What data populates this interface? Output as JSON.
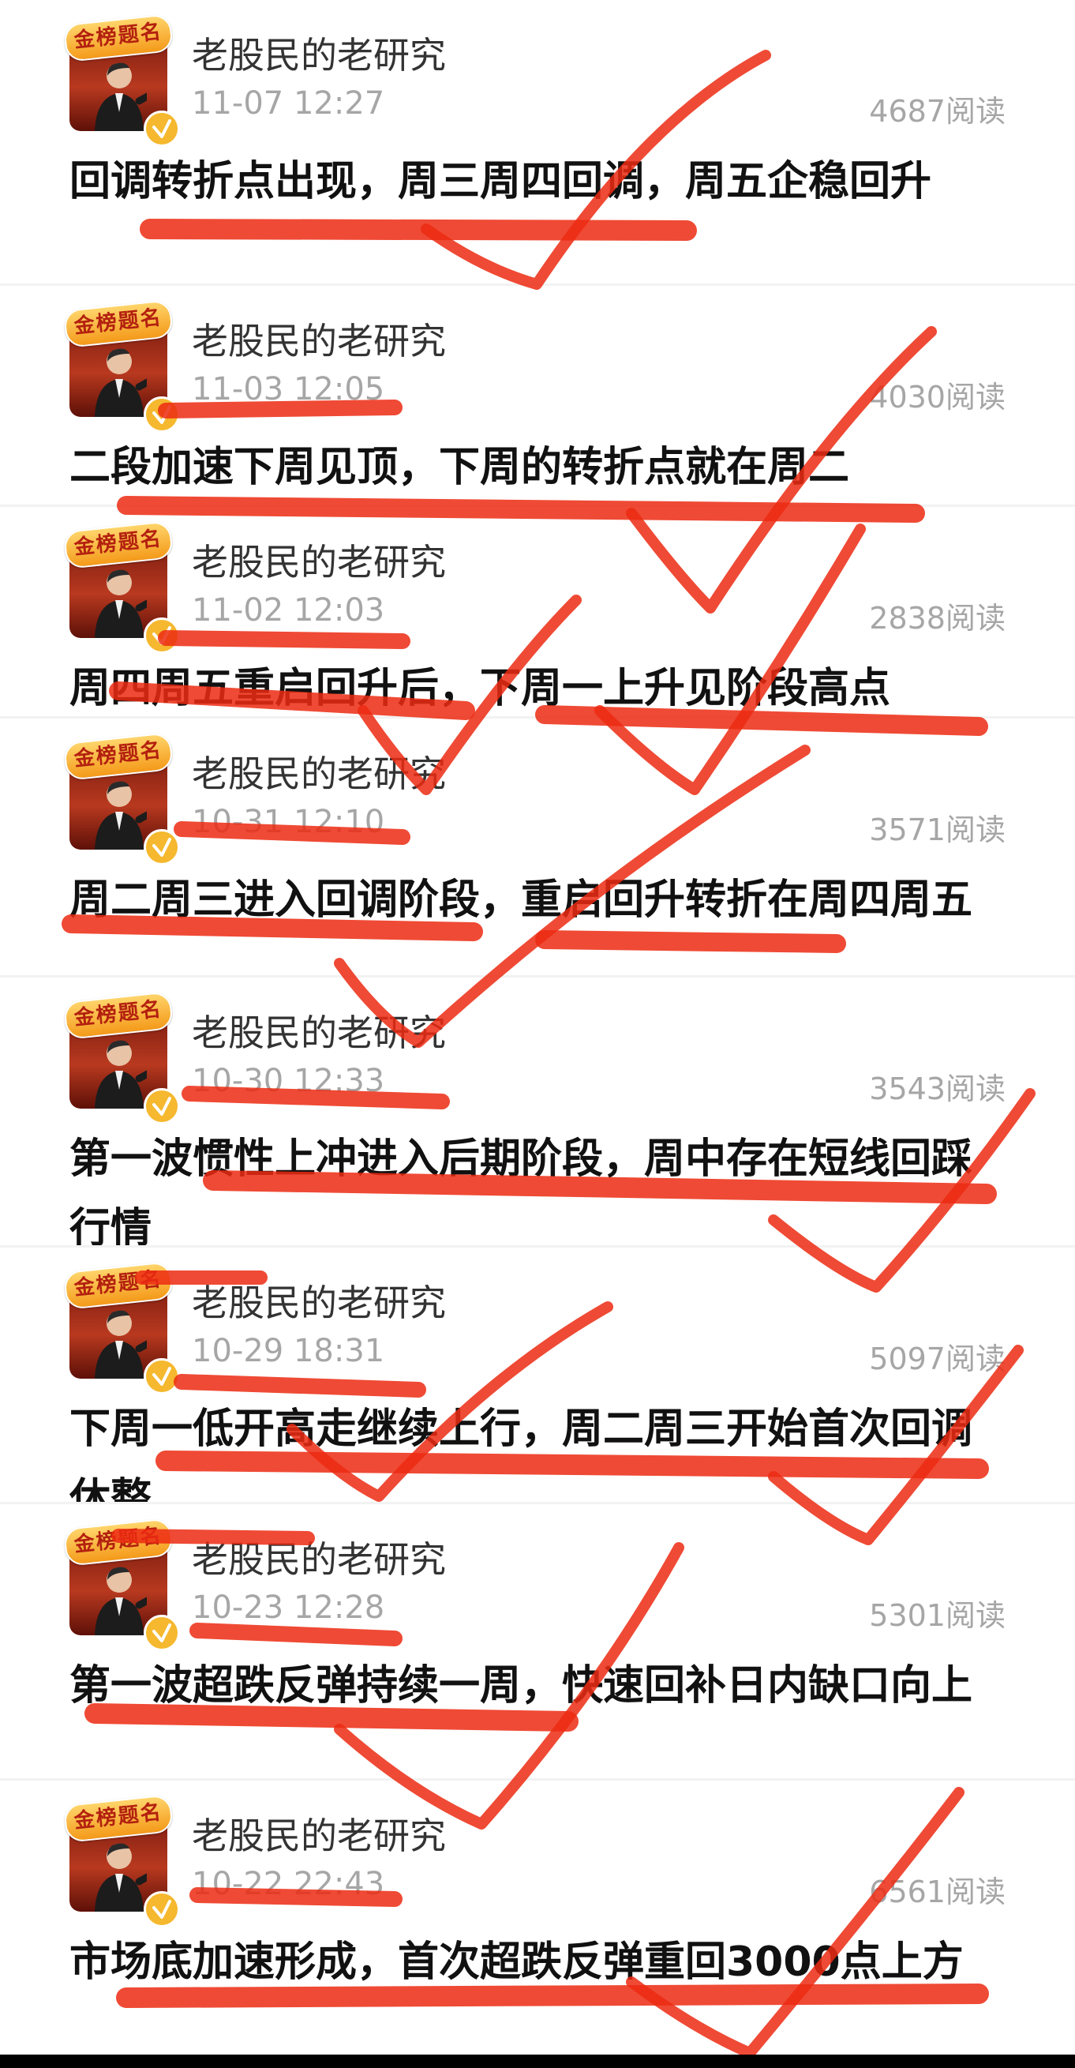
{
  "feed": {
    "posts": [
      {
        "author": "老股民的老研究",
        "time": "11-07 12:27",
        "reads": "4687阅读",
        "title": "回调转折点出现，周三周四回调，周五企稳回升"
      },
      {
        "author": "老股民的老研究",
        "time": "11-03 12:05",
        "reads": "4030阅读",
        "title": "二段加速下周见顶，下周的转折点就在周二"
      },
      {
        "author": "老股民的老研究",
        "time": "11-02 12:03",
        "reads": "2838阅读",
        "title": "周四周五重启回升后，下周一上升见阶段高点"
      },
      {
        "author": "老股民的老研究",
        "time": "10-31 12:10",
        "reads": "3571阅读",
        "title": "周二周三进入回调阶段，重启回升转折在周四周五"
      },
      {
        "author": "老股民的老研究",
        "time": "10-30 12:33",
        "reads": "3543阅读",
        "title": "第一波惯性上冲进入后期阶段，周中存在短线回踩行情"
      },
      {
        "author": "老股民的老研究",
        "time": "10-29 18:31",
        "reads": "5097阅读",
        "title": "下周一低开高走继续上行，周二周三开始首次回调休整"
      },
      {
        "author": "老股民的老研究",
        "time": "10-23 12:28",
        "reads": "5301阅读",
        "title": "第一波超跌反弹持续一周，快速回补日内缺口向上"
      },
      {
        "author": "老股民的老研究",
        "time": "10-22 22:43",
        "reads": "6561阅读",
        "title": "市场底加速形成，首次超跌反弹重回3000点上方"
      }
    ]
  },
  "avatar_badge_text": "金榜题名",
  "annotation_color": "#ec2a12",
  "verified_color": "#f5b82e"
}
